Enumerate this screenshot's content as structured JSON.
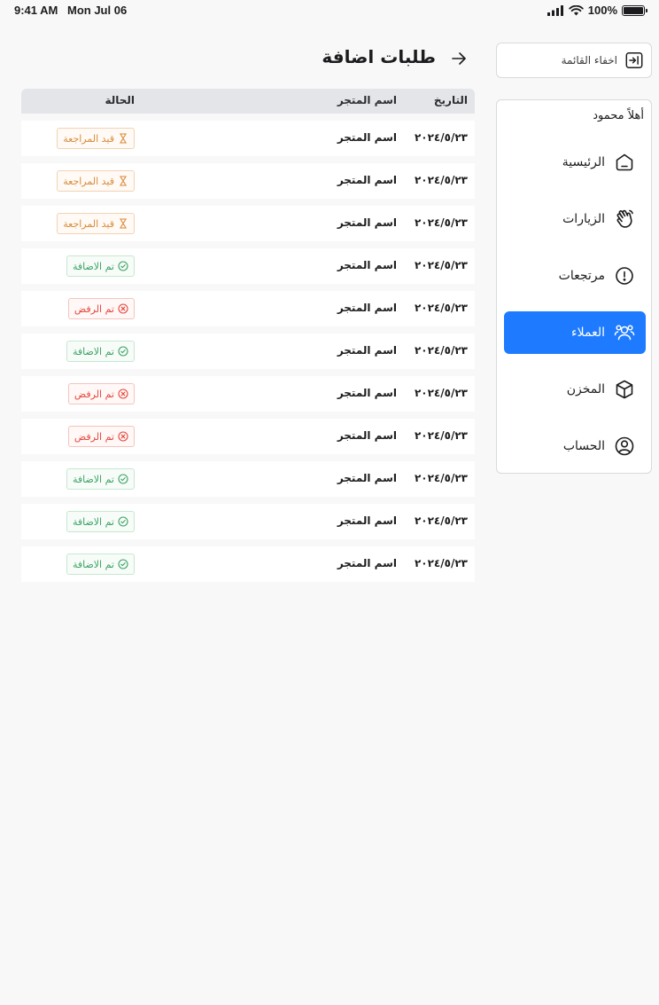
{
  "status_bar": {
    "time": "9:41 AM",
    "date": "Mon Jul 06",
    "battery": "100%",
    "battery_level": 1.0
  },
  "sidebar": {
    "hide_menu_label": "اخفاء القائمة",
    "greeting": "أهلاً محمود",
    "items": [
      {
        "label": "الرئيسية",
        "icon": "home-icon",
        "active": false
      },
      {
        "label": "الزيارات",
        "icon": "hand-wave-icon",
        "active": false
      },
      {
        "label": "مرتجعات",
        "icon": "alert-circle-icon",
        "active": false
      },
      {
        "label": "العملاء",
        "icon": "users-icon",
        "active": true
      },
      {
        "label": "المخزن",
        "icon": "box-icon",
        "active": false
      },
      {
        "label": "الحساب",
        "icon": "user-circle-icon",
        "active": false
      }
    ]
  },
  "main": {
    "title": "طلبات اضافة",
    "columns": {
      "date": "التاريخ",
      "store": "اسم المتجر",
      "status": "الحالة"
    },
    "rows": [
      {
        "date": "٢٠٢٤/٥/٢٣",
        "store": "اسم المتجر",
        "status": "قيد المراجعة",
        "kind": "pending"
      },
      {
        "date": "٢٠٢٤/٥/٢٣",
        "store": "اسم المتجر",
        "status": "قيد المراجعة",
        "kind": "pending"
      },
      {
        "date": "٢٠٢٤/٥/٢٣",
        "store": "اسم المتجر",
        "status": "قيد المراجعة",
        "kind": "pending"
      },
      {
        "date": "٢٠٢٤/٥/٢٣",
        "store": "اسم المتجر",
        "status": "تم الاضافة",
        "kind": "added"
      },
      {
        "date": "٢٠٢٤/٥/٢٣",
        "store": "اسم المتجر",
        "status": "تم الرفض",
        "kind": "rejected"
      },
      {
        "date": "٢٠٢٤/٥/٢٣",
        "store": "اسم المتجر",
        "status": "تم الاضافة",
        "kind": "added"
      },
      {
        "date": "٢٠٢٤/٥/٢٣",
        "store": "اسم المتجر",
        "status": "تم الرفض",
        "kind": "rejected"
      },
      {
        "date": "٢٠٢٤/٥/٢٣",
        "store": "اسم المتجر",
        "status": "تم الرفض",
        "kind": "rejected"
      },
      {
        "date": "٢٠٢٤/٥/٢٣",
        "store": "اسم المتجر",
        "status": "تم الاضافة",
        "kind": "added"
      },
      {
        "date": "٢٠٢٤/٥/٢٣",
        "store": "اسم المتجر",
        "status": "تم الاضافة",
        "kind": "added"
      },
      {
        "date": "٢٠٢٤/٥/٢٣",
        "store": "اسم المتجر",
        "status": "تم الاضافة",
        "kind": "added"
      }
    ]
  },
  "colors": {
    "accent": "#1e7bff",
    "pending": "#d98b3a",
    "added": "#3da364",
    "rejected": "#e5483d"
  }
}
